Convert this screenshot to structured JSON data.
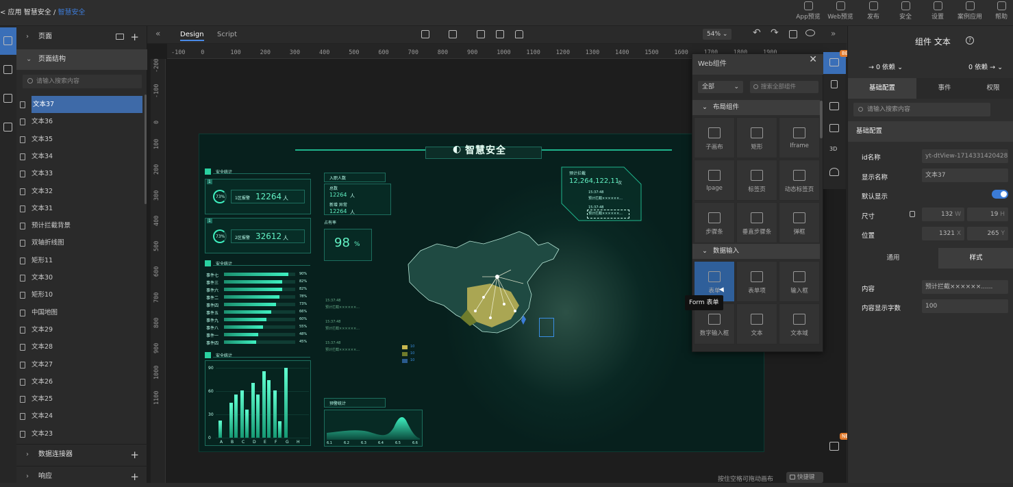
{
  "breadcrumb": {
    "root": "< 应用",
    "sep": "/",
    "app": "智慧安全",
    "current": "智慧安全"
  },
  "topbar": [
    {
      "label": "App预览",
      "icon": "phone-preview-icon"
    },
    {
      "label": "Web预览",
      "icon": "monitor-preview-icon"
    },
    {
      "label": "发布",
      "icon": "send-icon"
    },
    {
      "label": "安全",
      "icon": "shield-icon"
    },
    {
      "label": "设置",
      "icon": "gear-icon"
    },
    {
      "label": "案例应用",
      "icon": "document-icon"
    },
    {
      "label": "帮助",
      "icon": "help-icon"
    }
  ],
  "left_panel": {
    "pages_label": "页面",
    "structure_label": "页面结构",
    "search_placeholder": "请输入搜索内容",
    "tree": [
      "文本37",
      "文本36",
      "文本35",
      "文本34",
      "文本33",
      "文本32",
      "文本31",
      "预计拦截背景",
      "双轴折线图",
      "矩形11",
      "文本30",
      "矩形10",
      "中国地图",
      "文本29",
      "文本28",
      "文本27",
      "文本26",
      "文本25",
      "文本24",
      "文本23"
    ],
    "selected_index": 0,
    "footer": [
      "数据连接器",
      "响应"
    ]
  },
  "canvas": {
    "tabs": [
      "Design",
      "Script"
    ],
    "active_tab": "Design",
    "zoom": "54%",
    "ruler_h": [
      "-100",
      "0",
      "100",
      "200",
      "300",
      "400",
      "500",
      "600",
      "700",
      "800",
      "900",
      "1000",
      "1100",
      "1200",
      "1300",
      "1400",
      "1500",
      "1600",
      "1700",
      "1800",
      "1900"
    ],
    "ruler_v": [
      "-200",
      "-100",
      "0",
      "100",
      "200",
      "300",
      "400",
      "500",
      "600",
      "700",
      "800",
      "900",
      "1000",
      "1100"
    ],
    "bottom_hint": "按住空格可拖动画布",
    "shortcut_label": "快捷键"
  },
  "dashboard": {
    "title": "智慧安全",
    "sec1": "安全统计",
    "stat1_idx": "1",
    "stat1_lbl": "1区报警",
    "stat1_val": "12264",
    "stat1_unit": "人",
    "ring1": "73%",
    "stat2_idx": "1",
    "stat2_lbl": "2区报警",
    "stat2_val": "32612",
    "stat2_unit": "人",
    "ring2": "73%",
    "sec2": "安全统计",
    "events": [
      {
        "name": "事件七",
        "pct": "90%",
        "v": 0.9
      },
      {
        "name": "事件三",
        "pct": "82%",
        "v": 0.82
      },
      {
        "name": "事件六",
        "pct": "82%",
        "v": 0.82
      },
      {
        "name": "事件二",
        "pct": "78%",
        "v": 0.78
      },
      {
        "name": "事件四",
        "pct": "73%",
        "v": 0.73
      },
      {
        "name": "事件五",
        "pct": "66%",
        "v": 0.66
      },
      {
        "name": "事件九",
        "pct": "60%",
        "v": 0.6
      },
      {
        "name": "事件八",
        "pct": "55%",
        "v": 0.55
      },
      {
        "name": "事件一",
        "pct": "48%",
        "v": 0.48
      },
      {
        "name": "事件四",
        "pct": "45%",
        "v": 0.45
      }
    ],
    "sec3": "安全统计",
    "bars_y": [
      "90",
      "60",
      "30",
      "0"
    ],
    "bars_x": [
      "A",
      "B",
      "C",
      "D",
      "E",
      "F",
      "G",
      "H"
    ],
    "bars": [
      {
        "a": 25,
        "b": 0
      },
      {
        "a": 50,
        "b": 62
      },
      {
        "a": 68,
        "b": 40
      },
      {
        "a": 78,
        "b": 62
      },
      {
        "a": 95,
        "b": 82
      },
      {
        "a": 68,
        "b": 24
      },
      {
        "a": 100,
        "b": 0
      },
      {
        "a": 0,
        "b": 0
      }
    ],
    "entry_title": "入职人数",
    "entry_total_lbl": "总数",
    "entry_total_val": "12264",
    "entry_total_unit": "人",
    "entry_new_lbl": "新增 异常",
    "entry_new_val": "12264",
    "entry_new_unit": "人",
    "ratio_lbl": "占有率",
    "ratio_val": "98",
    "ratio_unit": "%",
    "intercept_title": "预计拦截",
    "intercept_val": "12,264,122,11",
    "intercept_unit": "次",
    "intercept_rows": [
      "15:37:48",
      "预计拦截××××××...",
      "15:37:48",
      "预计拦截××××××..."
    ],
    "log": [
      "15:37:48",
      "预计拦截××××××...",
      "15:37:48",
      "预计拦截××××××...",
      "15:37:48",
      "预计拦截××××××..."
    ],
    "warn_title": "预警统计",
    "warn_x": [
      "6.1",
      "6.2",
      "6.3",
      "6.4",
      "6.5",
      "6.6"
    ],
    "legend": [
      "10",
      "10",
      "10"
    ]
  },
  "web_components": {
    "title": "Web组件",
    "filter": "全部",
    "search_placeholder": "搜索全部组件",
    "section_layout": "布局组件",
    "layout_items": [
      "子画布",
      "矩形",
      "Iframe",
      "Ipage",
      "标签页",
      "动态标签页",
      "步骤条",
      "垂直步骤条",
      "弹框"
    ],
    "section_input": "数据输入",
    "input_items": [
      "表单",
      "表单项",
      "输入框",
      "数字输入框",
      "文本",
      "文本域"
    ],
    "tooltip": "Form 表单"
  },
  "right_dock": {
    "beta": "BETA",
    "new": "NEW",
    "label_3d": "3D"
  },
  "right_panel": {
    "title": "组件 文本",
    "dep_left": "→ 0 依赖",
    "dep_right": "0 依赖 →",
    "tabs": [
      "基础配置",
      "事件",
      "权限"
    ],
    "search_placeholder": "请输入搜索内容",
    "section": "基础配置",
    "id_label": "id名称",
    "id_value": "yt-dtView-1714331420428",
    "name_label": "显示名称",
    "name_value": "文本37",
    "default_label": "默认显示",
    "size_label": "尺寸",
    "size_w": "132",
    "size_w_unit": "W",
    "size_h": "19",
    "size_h_unit": "H",
    "pos_label": "位置",
    "pos_x": "1321",
    "pos_x_unit": "X",
    "pos_y": "265",
    "pos_y_unit": "Y",
    "subtabs": [
      "通用",
      "样式"
    ],
    "content_label": "内容",
    "content_value": "预计拦截××××××......",
    "maxlen_label": "内容显示字数",
    "maxlen_value": "100"
  }
}
